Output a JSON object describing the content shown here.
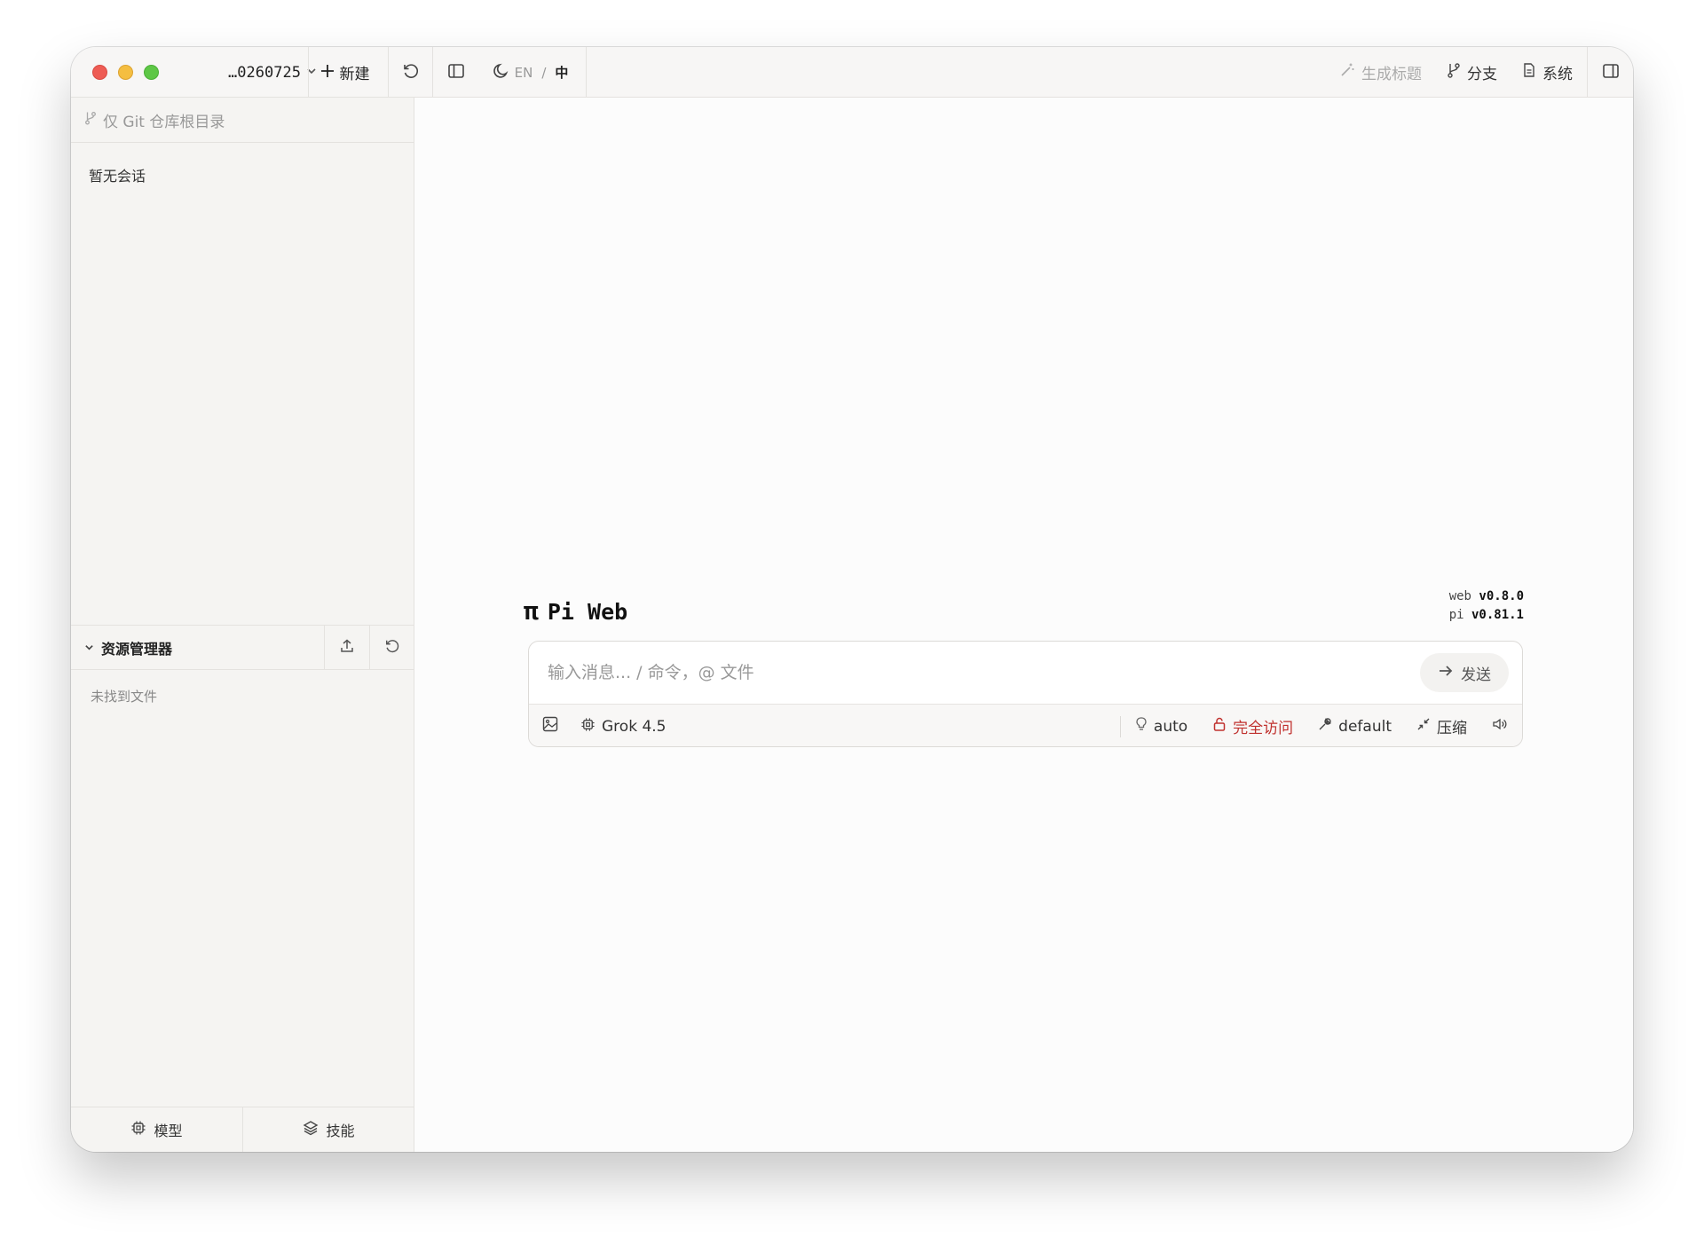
{
  "topbar": {
    "project_label": "…0260725",
    "new_label": "新建",
    "lang_en": "EN",
    "lang_sep": "/",
    "lang_zh": "中",
    "generate_title_label": "生成标题",
    "branch_label": "分支",
    "system_label": "系统"
  },
  "sidebar": {
    "filter_label": "仅 Git 仓库根目录",
    "empty_sessions": "暂无会话",
    "explorer_title": "资源管理器",
    "no_files": "未找到文件",
    "footer": {
      "models_label": "模型",
      "skills_label": "技能"
    }
  },
  "main": {
    "brand_symbol": "π",
    "brand_name": "Pi Web",
    "versions": {
      "web_key": "web",
      "web_value": "v0.8.0",
      "pi_key": "pi",
      "pi_value": "v0.81.1"
    },
    "composer": {
      "placeholder": "输入消息... / 命令，@ 文件",
      "send_label": "发送",
      "model_label": "Grok 4.5",
      "thinking_label": "auto",
      "access_label": "完全访问",
      "tools_label": "default",
      "compress_label": "压缩"
    }
  },
  "colors": {
    "access_red": "#c0312e",
    "traffic_red": "#ee5c54",
    "traffic_yellow": "#f5be40",
    "traffic_green": "#5ec746"
  }
}
